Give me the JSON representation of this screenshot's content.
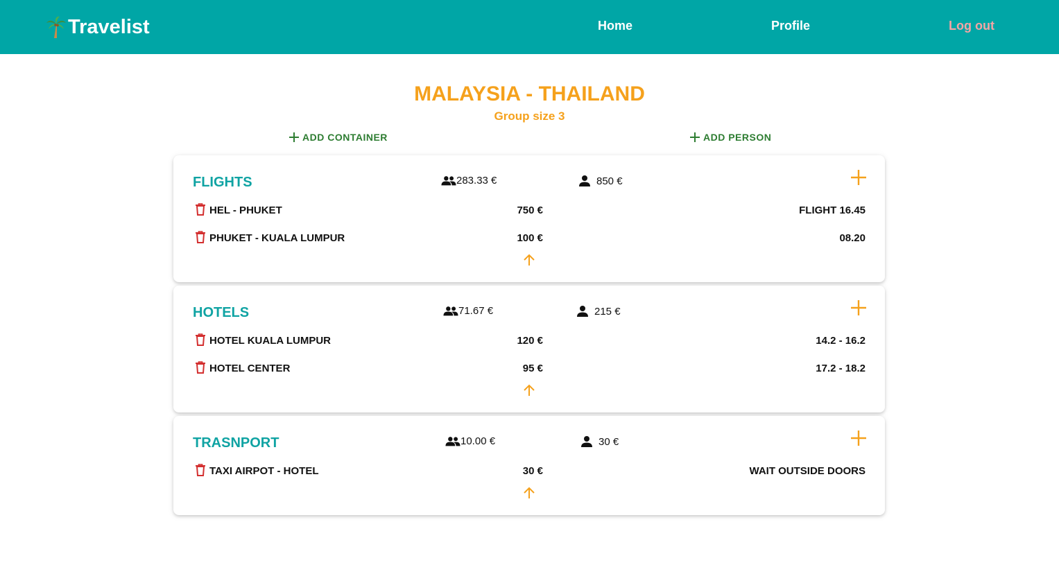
{
  "nav": {
    "brand": "Travelist",
    "home": "Home",
    "profile": "Profile",
    "logout": "Log out"
  },
  "trip": {
    "title": "MALAYSIA - THAILAND",
    "group_size": "Group size 3",
    "add_container": "ADD CONTAINER",
    "add_person": "ADD PERSON"
  },
  "colors": {
    "navbar": "#00A6A6",
    "accent_orange": "#F5A11C",
    "container_title": "#0FA3A3",
    "delete_red": "#D32F2F",
    "add_green": "#2E7D32",
    "logout_pink": "#F4A5A5"
  },
  "containers": [
    {
      "title": "FLIGHTS",
      "group_cost": "283.33 €",
      "person_cost": "850 €",
      "items": [
        {
          "name": "HEL - PHUKET",
          "price": "750 €",
          "note": "FLIGHT 16.45"
        },
        {
          "name": "PHUKET - KUALA LUMPUR",
          "price": "100 €",
          "note": "08.20"
        }
      ]
    },
    {
      "title": "HOTELS",
      "group_cost": "71.67 €",
      "person_cost": "215 €",
      "items": [
        {
          "name": "HOTEL KUALA LUMPUR",
          "price": "120 €",
          "note": "14.2 - 16.2"
        },
        {
          "name": "HOTEL CENTER",
          "price": "95 €",
          "note": "17.2 - 18.2"
        }
      ]
    },
    {
      "title": "TRASNPORT",
      "group_cost": "10.00 €",
      "person_cost": "30 €",
      "items": [
        {
          "name": "TAXI AIRPOT - HOTEL",
          "price": "30 €",
          "note": "WAIT OUTSIDE DOORS"
        }
      ]
    }
  ]
}
